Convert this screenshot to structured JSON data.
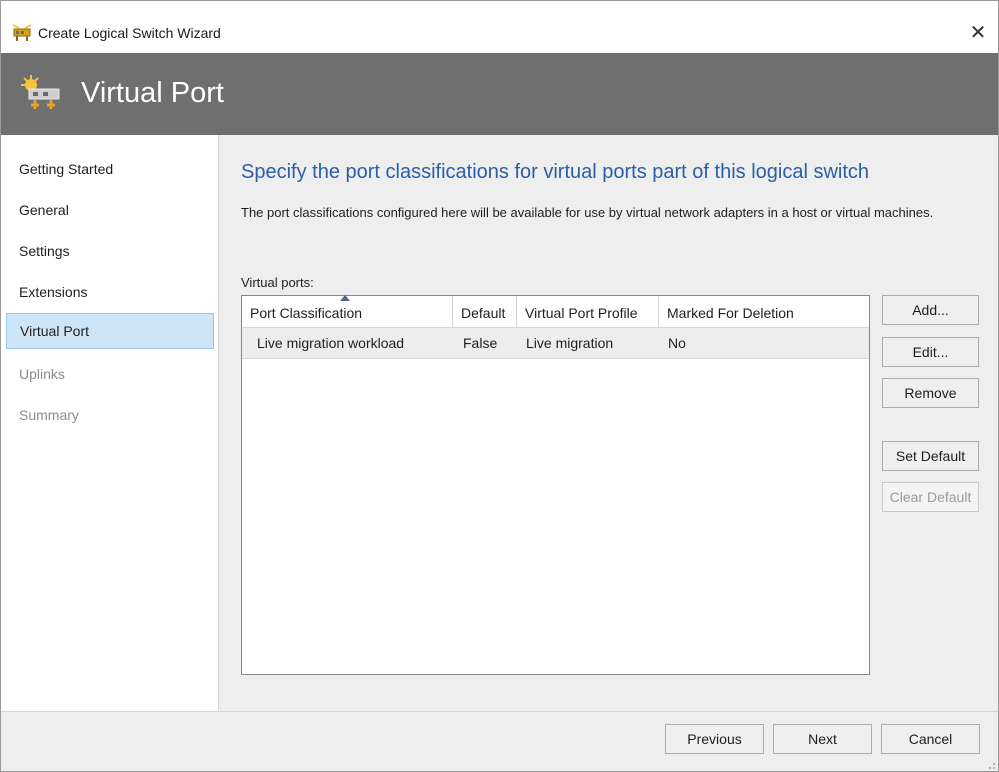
{
  "window": {
    "title": "Create Logical Switch Wizard",
    "close_glyph": "✕",
    "icon": "logical-switch-icon"
  },
  "header": {
    "title": "Virtual Port",
    "icon": "logical-switch-icon"
  },
  "nav": {
    "items": [
      {
        "label": "Getting Started",
        "state": "normal"
      },
      {
        "label": "General",
        "state": "normal"
      },
      {
        "label": "Settings",
        "state": "normal"
      },
      {
        "label": "Extensions",
        "state": "normal"
      },
      {
        "label": "Virtual Port",
        "state": "active"
      },
      {
        "label": "Uplinks",
        "state": "disabled"
      },
      {
        "label": "Summary",
        "state": "disabled"
      }
    ]
  },
  "page": {
    "title": "Specify the port classifications for virtual ports part of this logical switch",
    "description": "The port classifications configured here will be available for use by virtual network adapters in a host or virtual machines.",
    "list_label": "Virtual ports:"
  },
  "table": {
    "columns": [
      "Port Classification",
      "Default",
      "Virtual Port Profile",
      "Marked For Deletion"
    ],
    "sorted_column": "Port Classification",
    "rows": [
      [
        "Live migration  workload",
        "False",
        "Live migration",
        "No"
      ]
    ]
  },
  "actions": {
    "add": "Add...",
    "edit": "Edit...",
    "remove": "Remove",
    "set_default": "Set Default",
    "clear_default": "Clear Default"
  },
  "footer": {
    "previous": "Previous",
    "next": "Next",
    "cancel": "Cancel"
  },
  "colors": {
    "header_bg": "#6f6f6f",
    "page_title": "#2a5fa8",
    "nav_active_bg": "#cde5f7",
    "content_bg": "#eeeeee"
  }
}
